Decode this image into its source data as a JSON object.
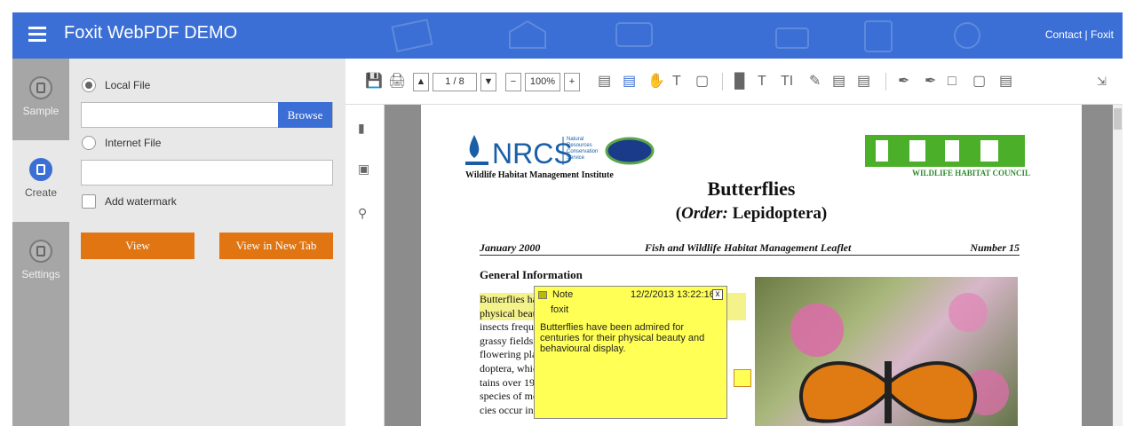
{
  "header": {
    "title": "Foxit WebPDF DEMO",
    "contact": "Contact | Foxit",
    "accent": "#3b6fd5"
  },
  "nav": {
    "items": [
      {
        "label": "Sample",
        "icon": "document-icon"
      },
      {
        "label": "Create",
        "icon": "document-icon"
      },
      {
        "label": "Settings",
        "icon": "document-icon"
      }
    ]
  },
  "panel": {
    "local_file_label": "Local File",
    "browse_label": "Browse",
    "internet_file_label": "Internet File",
    "watermark_label": "Add watermark",
    "view_label": "View",
    "view_new_tab_label": "View in New Tab",
    "button_color": "#e07511"
  },
  "toolbar": {
    "page_indicator": "1 / 8",
    "zoom": "100%"
  },
  "document": {
    "nrcs_logo_text": "NRCS",
    "nrcs_sub": "Natural Resources Conservation Service",
    "institute": "Wildlife Habitat Management Institute",
    "whc": "WILDLIFE HABITAT COUNCIL",
    "title": "Butterflies",
    "order_prefix": "Order:",
    "order_name": " Lepidoptera",
    "date": "January 2000",
    "series": "Fish and Wildlife Habitat Management Leaflet",
    "number": "Number 15",
    "section": "General Information",
    "body": [
      "Butterflies have been admired for centuries for their",
      "physical beauty and behavioral display. These colorful",
      "insects frequent meadows, wetlands, gardens,",
      "grassy fields, and woodlands, feeding on nectar from",
      "flowering plants. Butterflies belong to the order Lepi-",
      "doptera, which means scale-winged. The order con-",
      "tains over 19,000 species of butterflies and 100,000",
      "species of moths worldwide. Over 700 butterfly spe-",
      "cies occur in North America."
    ]
  },
  "note": {
    "label": "Note",
    "date": "12/2/2013 13:22:16",
    "close": "x",
    "author": "foxit",
    "text": "Butterflies have been admired for centuries for their physical beauty and behavioural display."
  }
}
